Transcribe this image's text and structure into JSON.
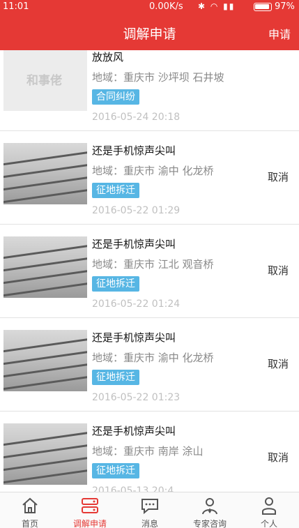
{
  "status_bar": {
    "time": "11:01",
    "net_speed": "0.00K/s",
    "battery": "97%"
  },
  "header": {
    "title": "调解申请",
    "apply_label": "申请"
  },
  "list": {
    "items": [
      {
        "title": "放放风",
        "region": "地域：重庆市 沙坪坝 石井坡",
        "tag": "合同纠纷",
        "time": "2016-05-24 20:18",
        "thumb_text": "和事佬",
        "cancel": ""
      },
      {
        "title": "还是手机惊声尖叫",
        "region": "地域：重庆市 渝中 化龙桥",
        "tag": "征地拆迁",
        "time": "2016-05-22 01:29",
        "cancel": "取消"
      },
      {
        "title": "还是手机惊声尖叫",
        "region": "地域：重庆市 江北 观音桥",
        "tag": "征地拆迁",
        "time": "2016-05-22 01:24",
        "cancel": "取消"
      },
      {
        "title": "还是手机惊声尖叫",
        "region": "地域：重庆市 渝中 化龙桥",
        "tag": "征地拆迁",
        "time": "2016-05-22 01:23",
        "cancel": "取消"
      },
      {
        "title": "还是手机惊声尖叫",
        "region": "地域：重庆市 南岸 涂山",
        "tag": "征地拆迁",
        "time": "2016-05-13 20:4",
        "cancel": "取消"
      }
    ]
  },
  "tabs": [
    {
      "label": "首页",
      "icon": "home-icon"
    },
    {
      "label": "调解申请",
      "icon": "list-icon",
      "active": true
    },
    {
      "label": "消息",
      "icon": "chat-icon"
    },
    {
      "label": "专家咨询",
      "icon": "expert-icon"
    },
    {
      "label": "个人",
      "icon": "person-icon"
    }
  ],
  "colors": {
    "accent": "#e53935",
    "tag": "#57b6e4"
  }
}
